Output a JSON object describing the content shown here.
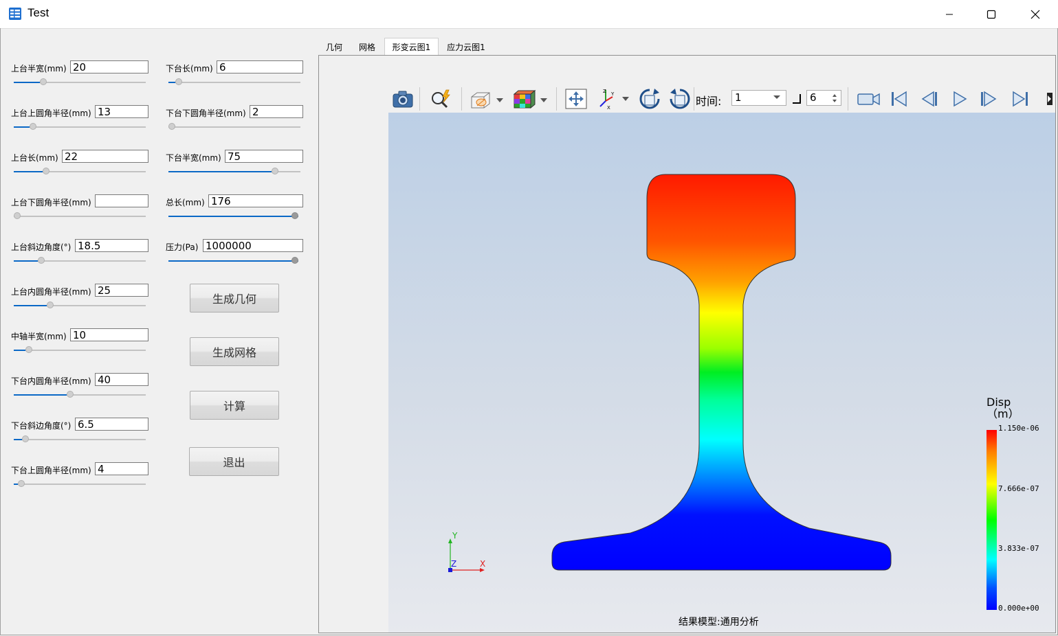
{
  "window": {
    "title": "Test",
    "app_icon": "table-app-icon"
  },
  "params_left": [
    {
      "label": "上台半宽(mm)",
      "value": "20",
      "slider": 0.2
    },
    {
      "label": "上台上圆角半径(mm)",
      "value": "13",
      "slider": 0.12
    },
    {
      "label": "上台长(mm)",
      "value": "22",
      "slider": 0.22
    },
    {
      "label": "上台下圆角半径(mm)",
      "value": "",
      "slider": 0.0
    },
    {
      "label": "上台斜边角度(°)",
      "value": "18.5",
      "slider": 0.18
    },
    {
      "label": "上台内圆角半径(mm)",
      "value": "25",
      "slider": 0.25
    },
    {
      "label": "中轴半宽(mm)",
      "value": "10",
      "slider": 0.09
    },
    {
      "label": "下台内圆角半径(mm)",
      "value": "40",
      "slider": 0.4
    },
    {
      "label": "下台斜边角度(°)",
      "value": "6.5",
      "slider": 0.06
    },
    {
      "label": "下台上圆角半径(mm)",
      "value": "4",
      "slider": 0.03
    }
  ],
  "params_right": [
    {
      "label": "下台长(mm)",
      "value": "6",
      "slider": 0.05
    },
    {
      "label": "下台下圆角半径(mm)",
      "value": "2",
      "slider": 0.0
    },
    {
      "label": "下台半宽(mm)",
      "value": "75",
      "slider": 0.78
    },
    {
      "label": "总长(mm)",
      "value": "176",
      "slider": 1.0
    },
    {
      "label": "压力(Pa)",
      "value": "1000000",
      "slider": 1.0
    }
  ],
  "buttons": {
    "gen_geometry": "生成几何",
    "gen_mesh": "生成网格",
    "compute": "计算",
    "exit": "退出"
  },
  "tabs": [
    {
      "label": "几何",
      "active": false
    },
    {
      "label": "网格",
      "active": false
    },
    {
      "label": "形变云图1",
      "active": true
    },
    {
      "label": "应力云图1",
      "active": false
    }
  ],
  "toolbar": {
    "time_label": "时间:",
    "time_value": "1",
    "step_value": "6"
  },
  "legend": {
    "title_line1": "Disp",
    "title_line2": "（m）",
    "max": "1.150e-06",
    "t2": "7.666e-07",
    "t1": "3.833e-07",
    "min": "0.000e+00"
  },
  "axes": {
    "y": "Y",
    "z": "Z",
    "x": "X"
  },
  "model_caption": "结果模型:通用分析",
  "colors": {
    "accent": "#0a68c6",
    "viewport_top": "#bccfe6",
    "viewport_bottom": "#e7e9ee"
  }
}
